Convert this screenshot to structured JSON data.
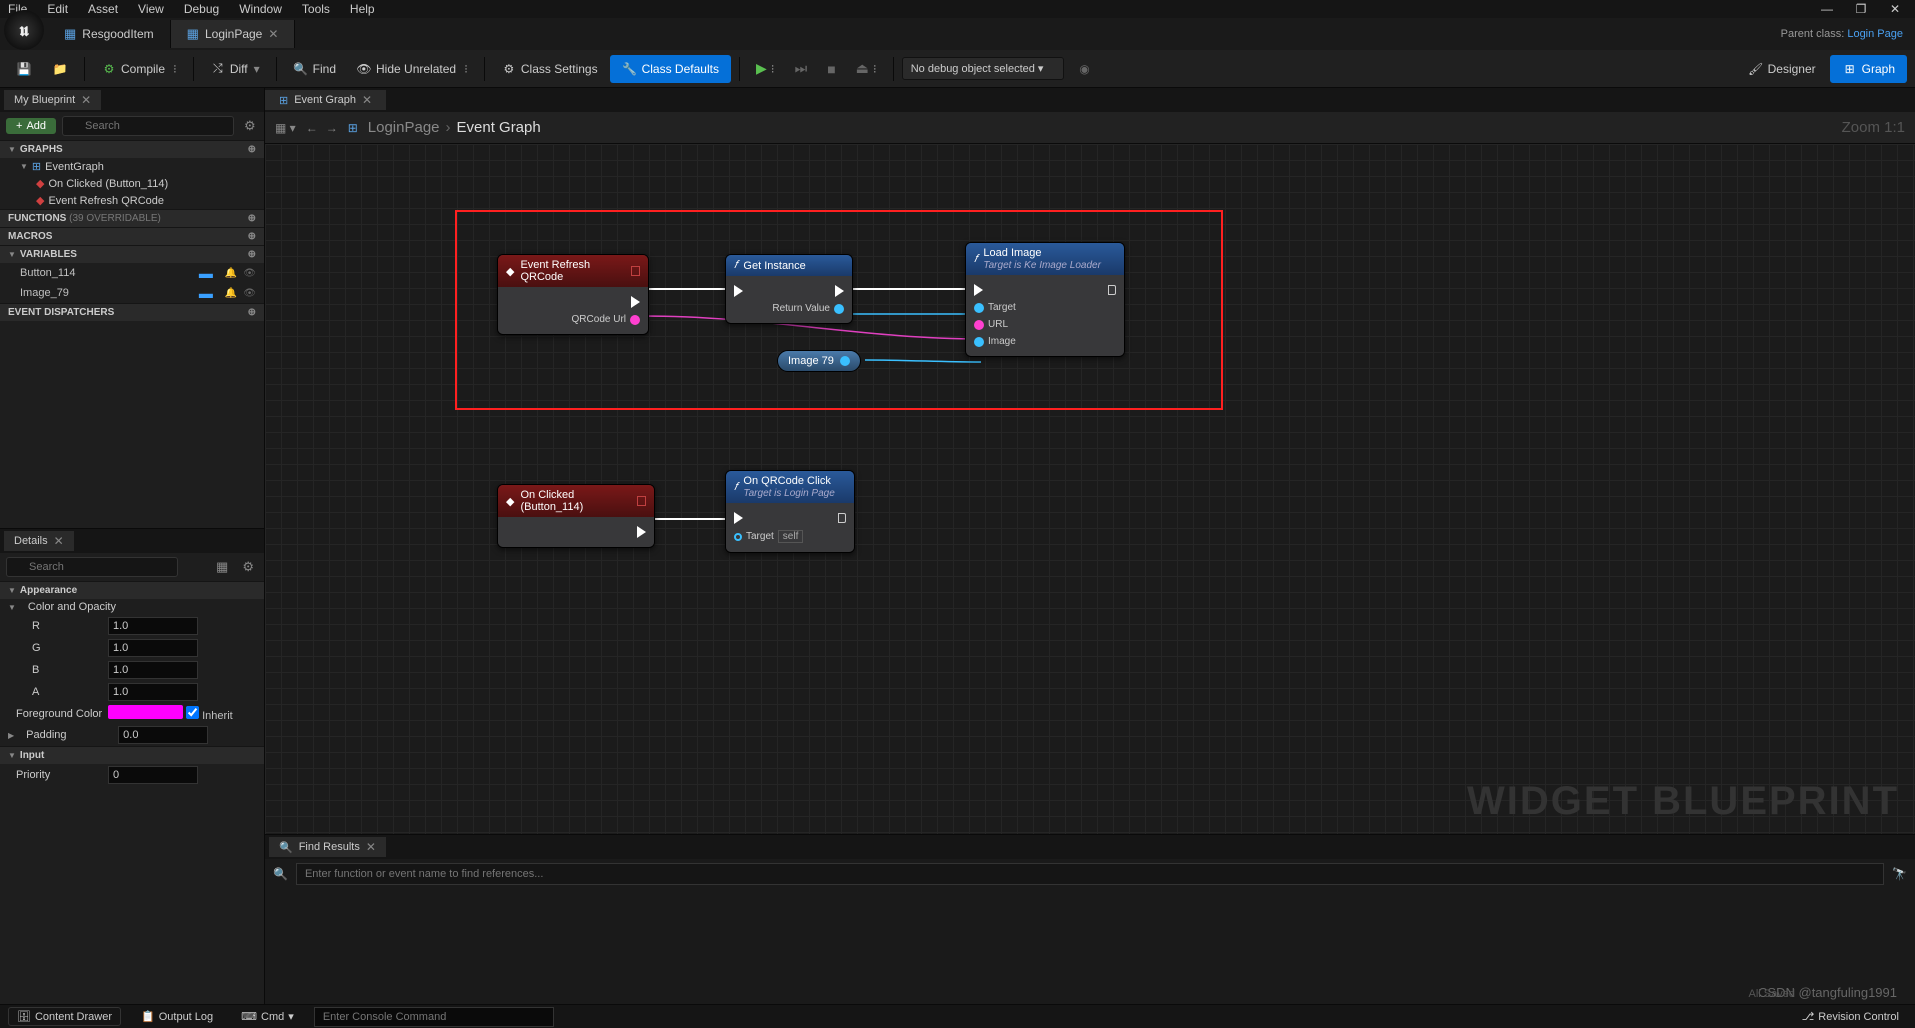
{
  "menu": {
    "items": [
      "File",
      "Edit",
      "Asset",
      "View",
      "Debug",
      "Window",
      "Tools",
      "Help"
    ]
  },
  "window_controls": [
    "—",
    "❐",
    "✕"
  ],
  "docTabs": [
    {
      "label": "ResgoodItem",
      "active": false
    },
    {
      "label": "LoginPage",
      "active": true
    }
  ],
  "parentClass": {
    "prefix": "Parent class:",
    "link": "Login Page"
  },
  "toolbar": {
    "compile": "Compile",
    "diff": "Diff",
    "find": "Find",
    "hideUnrelated": "Hide Unrelated",
    "classSettings": "Class Settings",
    "classDefaults": "Class Defaults",
    "debugObject": "No debug object selected",
    "designer": "Designer",
    "graph": "Graph"
  },
  "myBlueprint": {
    "tab": "My Blueprint",
    "add": "Add",
    "search": "Search",
    "graphs_header": "GRAPHS",
    "eventGraph": "EventGraph",
    "events": [
      "On Clicked (Button_114)",
      "Event Refresh QRCode"
    ],
    "functions_header": "FUNCTIONS",
    "functions_sub": "(39 OVERRIDABLE)",
    "macros_header": "MACROS",
    "variables_header": "VARIABLES",
    "variables": [
      "Button_114",
      "Image_79"
    ],
    "eventDispatchers_header": "EVENT DISPATCHERS"
  },
  "details": {
    "tab": "Details",
    "search": "Search",
    "appearance": "Appearance",
    "colorOpacity": "Color and Opacity",
    "r": "R",
    "g": "G",
    "b": "B",
    "a": "A",
    "r_val": "1.0",
    "g_val": "1.0",
    "b_val": "1.0",
    "a_val": "1.0",
    "fg": "Foreground Color",
    "inherit": "Inherit",
    "padding": "Padding",
    "padding_val": "0.0",
    "input": "Input",
    "priority": "Priority",
    "priority_val": "0"
  },
  "graphTab": "Event Graph",
  "crumb": {
    "bp": "LoginPage",
    "graph": "Event Graph",
    "zoom": "Zoom 1:1"
  },
  "nodes": {
    "refresh": {
      "title": "Event Refresh QRCode",
      "out_pin": "QRCode Url"
    },
    "getInstance": {
      "title": "Get Instance",
      "ret": "Return Value"
    },
    "loadImage": {
      "title": "Load Image",
      "sub": "Target is Ke Image Loader",
      "p1": "Target",
      "p2": "URL",
      "p3": "Image"
    },
    "image79": "Image 79",
    "onClicked": {
      "title": "On Clicked (Button_114)"
    },
    "onQRClick": {
      "title": "On QRCode Click",
      "sub": "Target is Login Page",
      "target": "Target",
      "self": "self"
    }
  },
  "watermark": "WIDGET BLUEPRINT",
  "csdn": "CSDN @tangfuling1991",
  "allsaved": "All Saved",
  "findResults": {
    "tab": "Find Results",
    "placeholder": "Enter function or event name to find references..."
  },
  "statusbar": {
    "contentDrawer": "Content Drawer",
    "outputLog": "Output Log",
    "cmd": "Cmd",
    "consolePlaceholder": "Enter Console Command",
    "revision": "Revision Control"
  }
}
